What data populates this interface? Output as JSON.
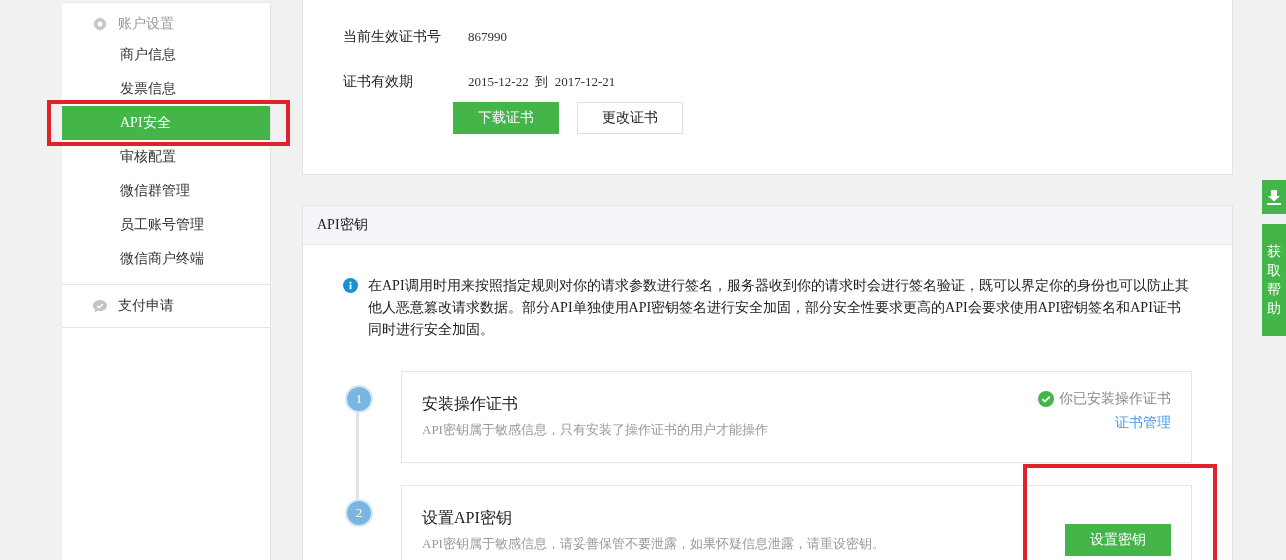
{
  "sidebar": {
    "sections": [
      {
        "title": "账户设置",
        "items": [
          {
            "label": "商户信息",
            "selected": false
          },
          {
            "label": "发票信息",
            "selected": false
          },
          {
            "label": "API安全",
            "selected": true
          },
          {
            "label": "审核配置",
            "selected": false
          },
          {
            "label": "微信群管理",
            "selected": false
          },
          {
            "label": "员工账号管理",
            "selected": false
          },
          {
            "label": "微信商户终端",
            "selected": false
          }
        ]
      },
      {
        "title": "支付申请"
      }
    ]
  },
  "certificate": {
    "fields": [
      {
        "label": "当前生效证书号",
        "value": "867990"
      },
      {
        "label": "证书有效期",
        "value": "2015-12-22  到  2017-12-21"
      }
    ],
    "buttons": [
      {
        "label": "下载证书",
        "kind": "primary"
      },
      {
        "label": "更改证书",
        "kind": "default"
      }
    ]
  },
  "api_key": {
    "title": "API密钥",
    "info": "在API调用时用来按照指定规则对你的请求参数进行签名，服务器收到你的请求时会进行签名验证，既可以界定你的身份也可以防止其他人恶意篡改请求数据。部分API单独使用API密钥签名进行安全加固，部分安全性要求更高的API会要求使用API密钥签名和API证书同时进行安全加固。",
    "steps": [
      {
        "number": "1",
        "title": "安装操作证书",
        "description": "API密钥属于敏感信息，只有安装了操作证书的用户才能操作",
        "status": "你已安装操作证书",
        "link": "证书管理"
      },
      {
        "number": "2",
        "title": "设置API密钥",
        "description": "API密钥属于敏感信息，请妥善保管不要泄露，如果怀疑信息泄露，请重设密钥。",
        "button": "设置密钥"
      }
    ]
  },
  "side_tools": {
    "help": "获取帮助"
  }
}
